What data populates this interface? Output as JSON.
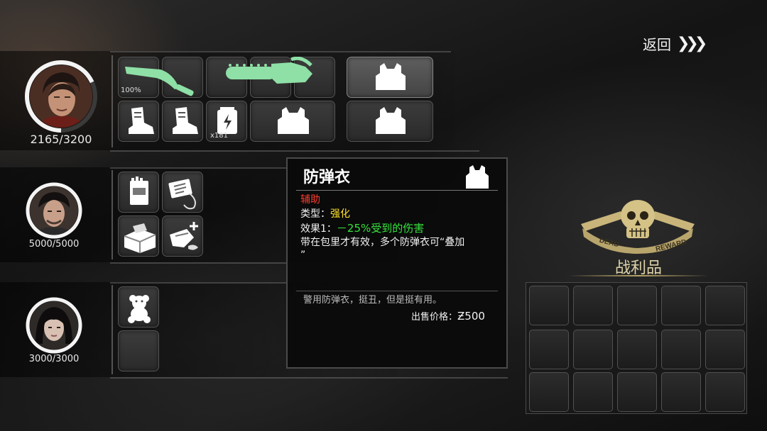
{
  "nav": {
    "back_label": "返回",
    "back_chevrons": "❯❯❯"
  },
  "characters": [
    {
      "hp": "2165/3200",
      "hp_ratio": 0.68
    },
    {
      "hp": "5000/5000",
      "hp_ratio": 1.0
    },
    {
      "hp": "3000/3000",
      "hp_ratio": 1.0
    }
  ],
  "equipment": {
    "machete_durability": "100%",
    "battery_count": "x181"
  },
  "tooltip": {
    "title": "防弹衣",
    "category": "辅助",
    "type_label": "类型：",
    "type_value": "强化",
    "effect_label": "效果1：",
    "effect_value": "－25%受到的伤害",
    "note_line1": "带在包里才有效，多个防弹衣可“叠加",
    "note_line2": "”",
    "flavor": "警用防弹衣，挺丑，但是挺有用。",
    "price_label": "出售价格：",
    "price_value": "Ƶ500"
  },
  "loot": {
    "title": "战利品",
    "emblem_left": "DEAD",
    "emblem_right": "REWARD"
  },
  "colors": {
    "item_green": "#8ee0a6",
    "category_red": "#ff3b2f",
    "type_yellow": "#ffe02a",
    "effect_green": "#36e33c",
    "emblem_gold": "#c9b57a"
  }
}
